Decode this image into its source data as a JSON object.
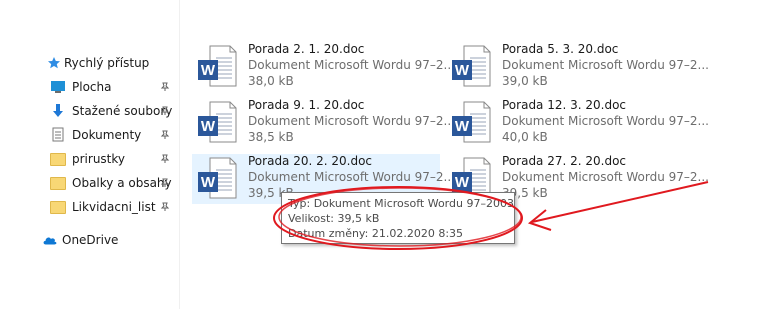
{
  "nav": {
    "quick_access": "Rychlý přístup",
    "items": [
      {
        "label": "Plocha",
        "icon": "desktop-icon",
        "pinned": true
      },
      {
        "label": "Stažené soubory",
        "icon": "download-icon",
        "pinned": true
      },
      {
        "label": "Dokumenty",
        "icon": "documents-icon",
        "pinned": true
      },
      {
        "label": "prirustky",
        "icon": "folder-icon",
        "pinned": true
      },
      {
        "label": "Obalky a obsahy",
        "icon": "folder-icon",
        "pinned": true
      },
      {
        "label": "Likvidacni_list",
        "icon": "folder-icon",
        "pinned": true
      }
    ],
    "onedrive": "OneDrive"
  },
  "files": [
    {
      "name": "Porada 2. 1. 20.doc",
      "type": "Dokument Microsoft Wordu 97–2...",
      "size": "38,0 kB"
    },
    {
      "name": "Porada 5. 3. 20.doc",
      "type": "Dokument Microsoft Wordu 97–2...",
      "size": "39,0 kB"
    },
    {
      "name": "Porada 9. 1. 20.doc",
      "type": "Dokument Microsoft Wordu 97–2...",
      "size": "38,5 kB"
    },
    {
      "name": "Porada 12. 3. 20.doc",
      "type": "Dokument Microsoft Wordu 97–2...",
      "size": "40,0 kB"
    },
    {
      "name": "Porada 20. 2. 20.doc",
      "type": "Dokument Microsoft Wordu 97–2...",
      "size": "39,5 kB",
      "selected": true
    },
    {
      "name": "Porada 27. 2. 20.doc",
      "type": "Dokument Microsoft Wordu 97–2...",
      "size": "39,5 kB"
    }
  ],
  "tooltip": {
    "type": "Typ: Dokument Microsoft Wordu 97–2003",
    "size": "Velikost: 39,5 kB",
    "modified": "Datum změny: 21.02.2020 8:35"
  },
  "colors": {
    "annotation": "#e0191f",
    "word_blue": "#2b579a",
    "selection": "#e5f3ff"
  }
}
